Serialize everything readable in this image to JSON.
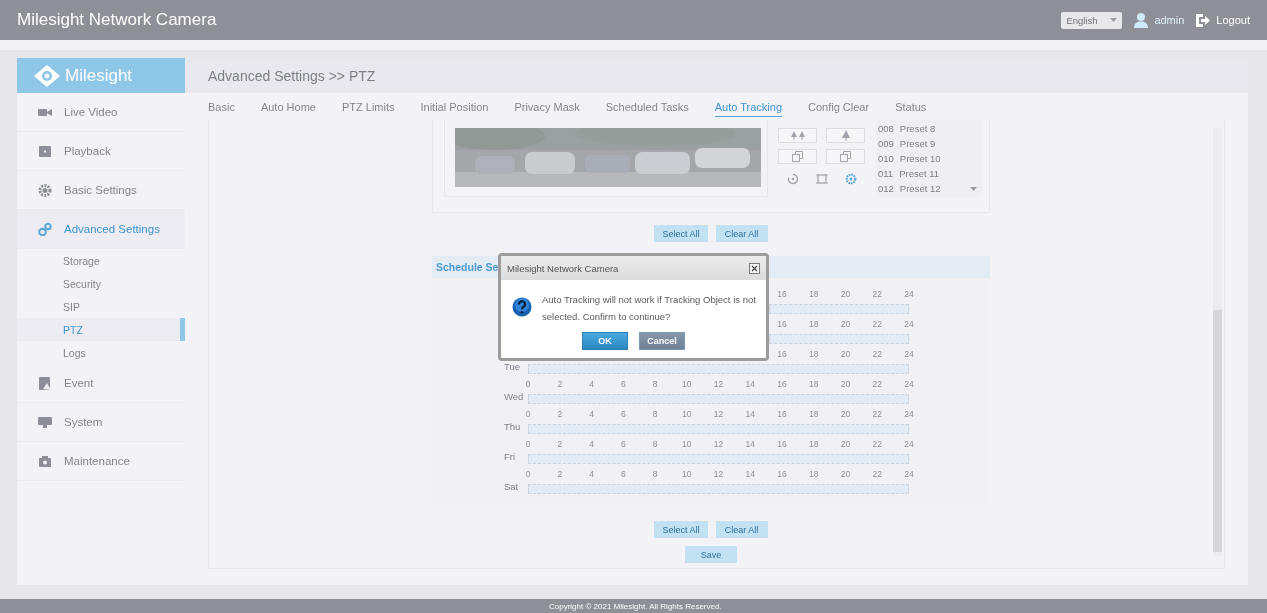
{
  "header": {
    "title": "Milesight Network Camera",
    "language": {
      "value": "English"
    },
    "user": "admin",
    "logout": "Logout"
  },
  "logo": "Milesight",
  "sidebar": {
    "items": [
      {
        "label": "Live Video",
        "selected": false
      },
      {
        "label": "Playback",
        "selected": false
      },
      {
        "label": "Basic Settings",
        "selected": false
      },
      {
        "label": "Advanced Settings",
        "selected": true,
        "children": [
          {
            "label": "Storage",
            "selected": false
          },
          {
            "label": "Security",
            "selected": false
          },
          {
            "label": "SIP",
            "selected": false
          },
          {
            "label": "PTZ",
            "selected": true
          },
          {
            "label": "Logs",
            "selected": false
          }
        ]
      },
      {
        "label": "Event",
        "selected": false
      },
      {
        "label": "System",
        "selected": false
      },
      {
        "label": "Maintenance",
        "selected": false
      }
    ]
  },
  "breadcrumb": "Advanced Settings >> PTZ",
  "tabs": [
    {
      "label": "Basic",
      "selected": false
    },
    {
      "label": "Auto Home",
      "selected": false
    },
    {
      "label": "PTZ Limits",
      "selected": false
    },
    {
      "label": "Initial Position",
      "selected": false
    },
    {
      "label": "Privacy Mask",
      "selected": false
    },
    {
      "label": "Scheduled Tasks",
      "selected": false
    },
    {
      "label": "Auto Tracking",
      "selected": true
    },
    {
      "label": "Config Clear",
      "selected": false
    },
    {
      "label": "Status",
      "selected": false
    }
  ],
  "camera": {
    "tools": [
      {
        "selected": false
      },
      {
        "selected": false
      },
      {
        "selected": true
      }
    ],
    "presets": [
      {
        "number": "008",
        "name": "Preset 8"
      },
      {
        "number": "009",
        "name": "Preset 9"
      },
      {
        "number": "010",
        "name": "Preset 10"
      },
      {
        "number": "011",
        "name": "Preset 11"
      },
      {
        "number": "012",
        "name": "Preset 12"
      }
    ]
  },
  "area_buttons": [
    "Select All",
    "Clear All"
  ],
  "schedule": {
    "title": "Schedule Se",
    "rows": [
      {
        "ticks": [
          "16",
          "18",
          "20",
          "22",
          "24"
        ]
      },
      {
        "ticks": [
          "16",
          "18",
          "20",
          "22",
          "24"
        ]
      },
      {
        "label": "Tue",
        "ticks": [
          "16",
          "18",
          "20",
          "22",
          "24"
        ]
      },
      {
        "label": "Wed",
        "ticks": [
          "0",
          "2",
          "4",
          "6",
          "8",
          "10",
          "12",
          "14",
          "16",
          "18",
          "20",
          "22",
          "24"
        ]
      },
      {
        "label": "Thu",
        "ticks": [
          "0",
          "2",
          "4",
          "6",
          "8",
          "10",
          "12",
          "14",
          "16",
          "18",
          "20",
          "22",
          "24"
        ]
      },
      {
        "label": "Fri",
        "ticks": [
          "0",
          "2",
          "4",
          "6",
          "8",
          "10",
          "12",
          "14",
          "16",
          "18",
          "20",
          "22",
          "24"
        ]
      },
      {
        "label": "Sat",
        "ticks": [
          "0",
          "2",
          "4",
          "6",
          "8",
          "10",
          "12",
          "14",
          "16",
          "18",
          "20",
          "22",
          "24"
        ]
      }
    ]
  },
  "schedule_buttons": [
    "Select All",
    "Clear All"
  ],
  "save": "Save",
  "dialog": {
    "title": "Milesight Network Camera",
    "message": "Auto Tracking will not work if Tracking Object is not selected. Confirm to continue?",
    "buttons": [
      {
        "label": "OK",
        "kind": "primary"
      },
      {
        "label": "Cancel",
        "kind": "secondary"
      }
    ]
  },
  "footer": "Copyright © 2021 Milesight. All Rights Reserved."
}
